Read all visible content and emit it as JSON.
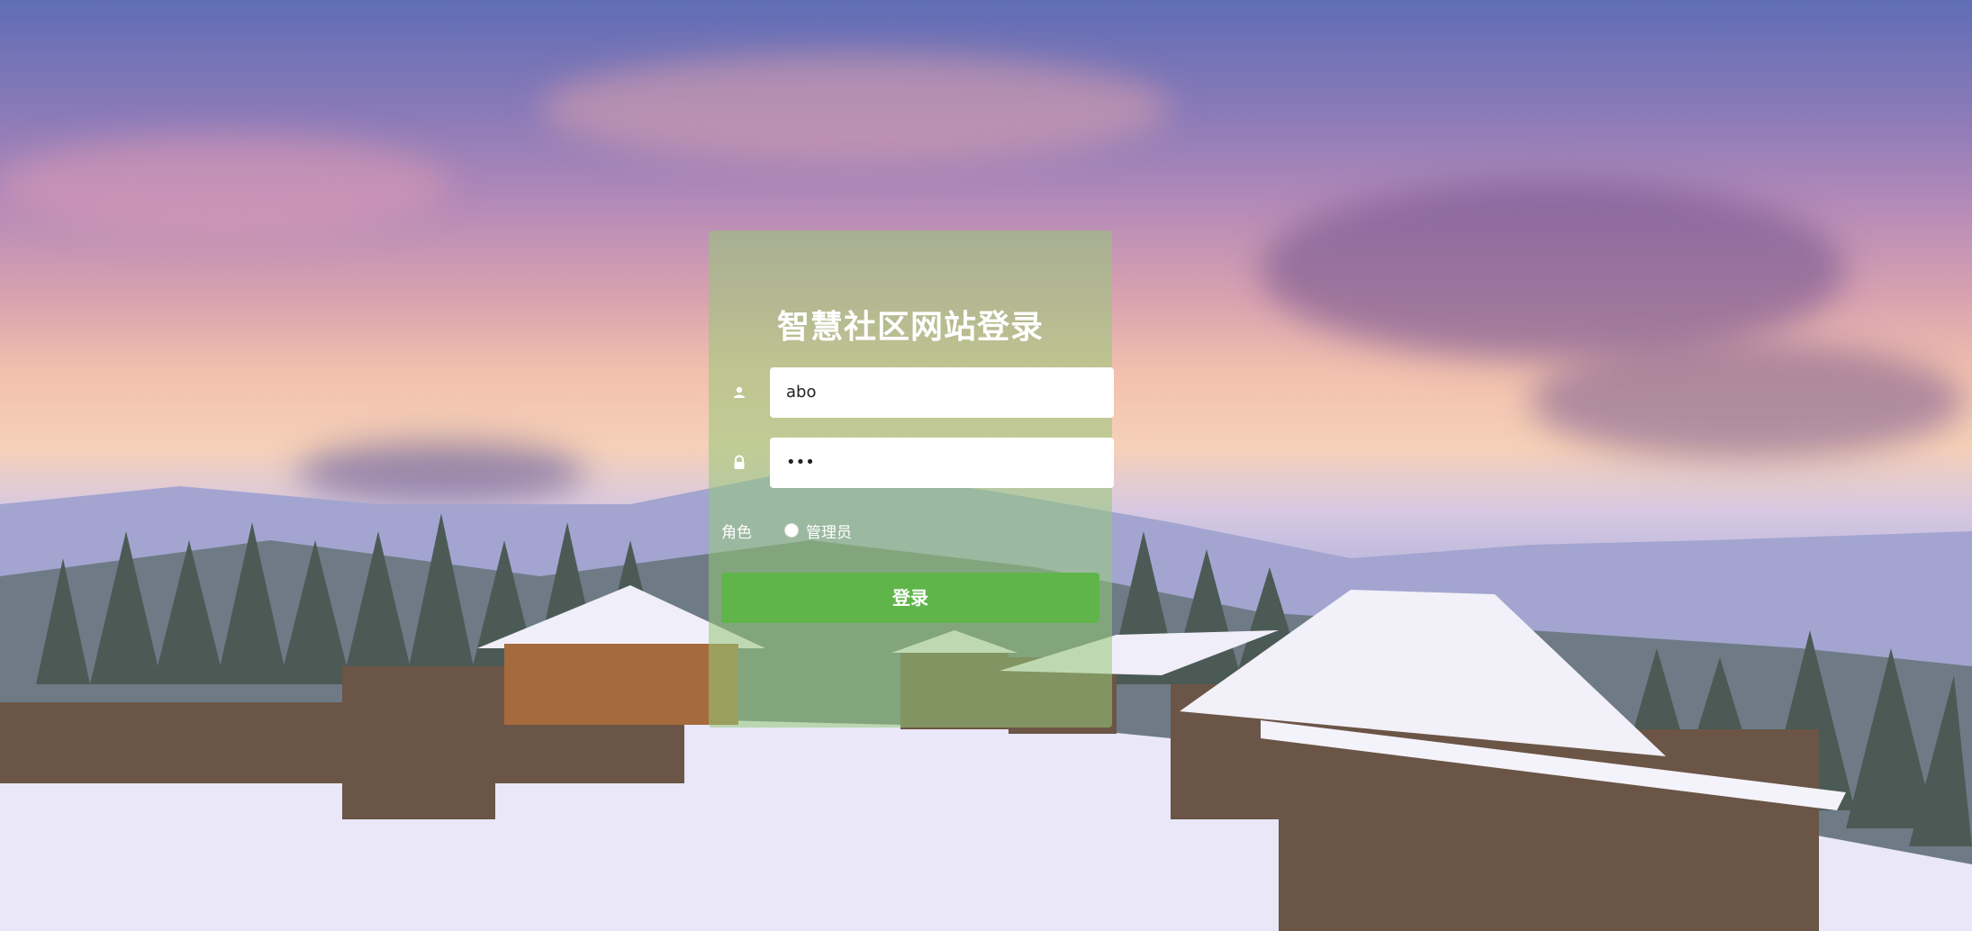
{
  "login": {
    "title": "智慧社区网站登录",
    "username": {
      "value": "abo",
      "icon": "user-icon"
    },
    "password": {
      "value": "•••",
      "icon": "lock-icon"
    },
    "role": {
      "label": "角色",
      "options": [
        "管理员"
      ]
    },
    "submit_label": "登录"
  },
  "colors": {
    "panel": "#96c878",
    "button": "#5fb54a",
    "text": "#ffffff"
  }
}
